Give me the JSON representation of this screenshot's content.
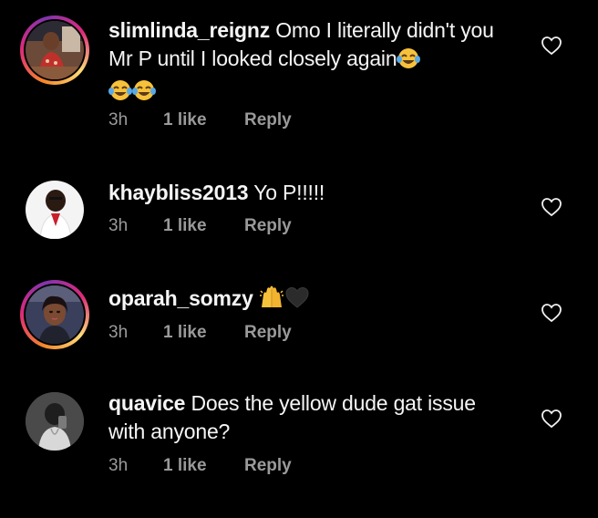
{
  "comments": [
    {
      "username": "slimlinda_reignz",
      "text": "Omo I literally didn't you Mr P until I looked closely again",
      "emoji_trail": [
        "tears-of-joy",
        "tears-of-joy",
        "tears-of-joy"
      ],
      "time": "3h",
      "likes": "1 like",
      "reply": "Reply",
      "avatar_icon": "avatar-woman-red-dress",
      "has_story_ring": true
    },
    {
      "username": "khaybliss2013",
      "text": "Yo P!!!!!",
      "emoji_trail": [],
      "time": "3h",
      "likes": "1 like",
      "reply": "Reply",
      "avatar_icon": "avatar-man-white-background",
      "has_story_ring": false
    },
    {
      "username": "oparah_somzy",
      "text": "",
      "emoji_trail": [
        "raising-hands",
        "black-heart"
      ],
      "time": "3h",
      "likes": "1 like",
      "reply": "Reply",
      "avatar_icon": "avatar-woman-selfie",
      "has_story_ring": true
    },
    {
      "username": "quavice",
      "text": "Does the yellow dude gat issue with anyone?",
      "emoji_trail": [],
      "time": "3h",
      "likes": "1 like",
      "reply": "Reply",
      "avatar_icon": "avatar-man-mirror-selfie",
      "has_story_ring": false
    }
  ],
  "icons": {
    "like": "heart-outline-icon"
  },
  "colors": {
    "background": "#000000",
    "text": "#f5f5f5",
    "meta_text": "#9a9a9a",
    "story_ring": [
      "#f58529",
      "#dd2a7b",
      "#8134af",
      "#feda77"
    ]
  }
}
